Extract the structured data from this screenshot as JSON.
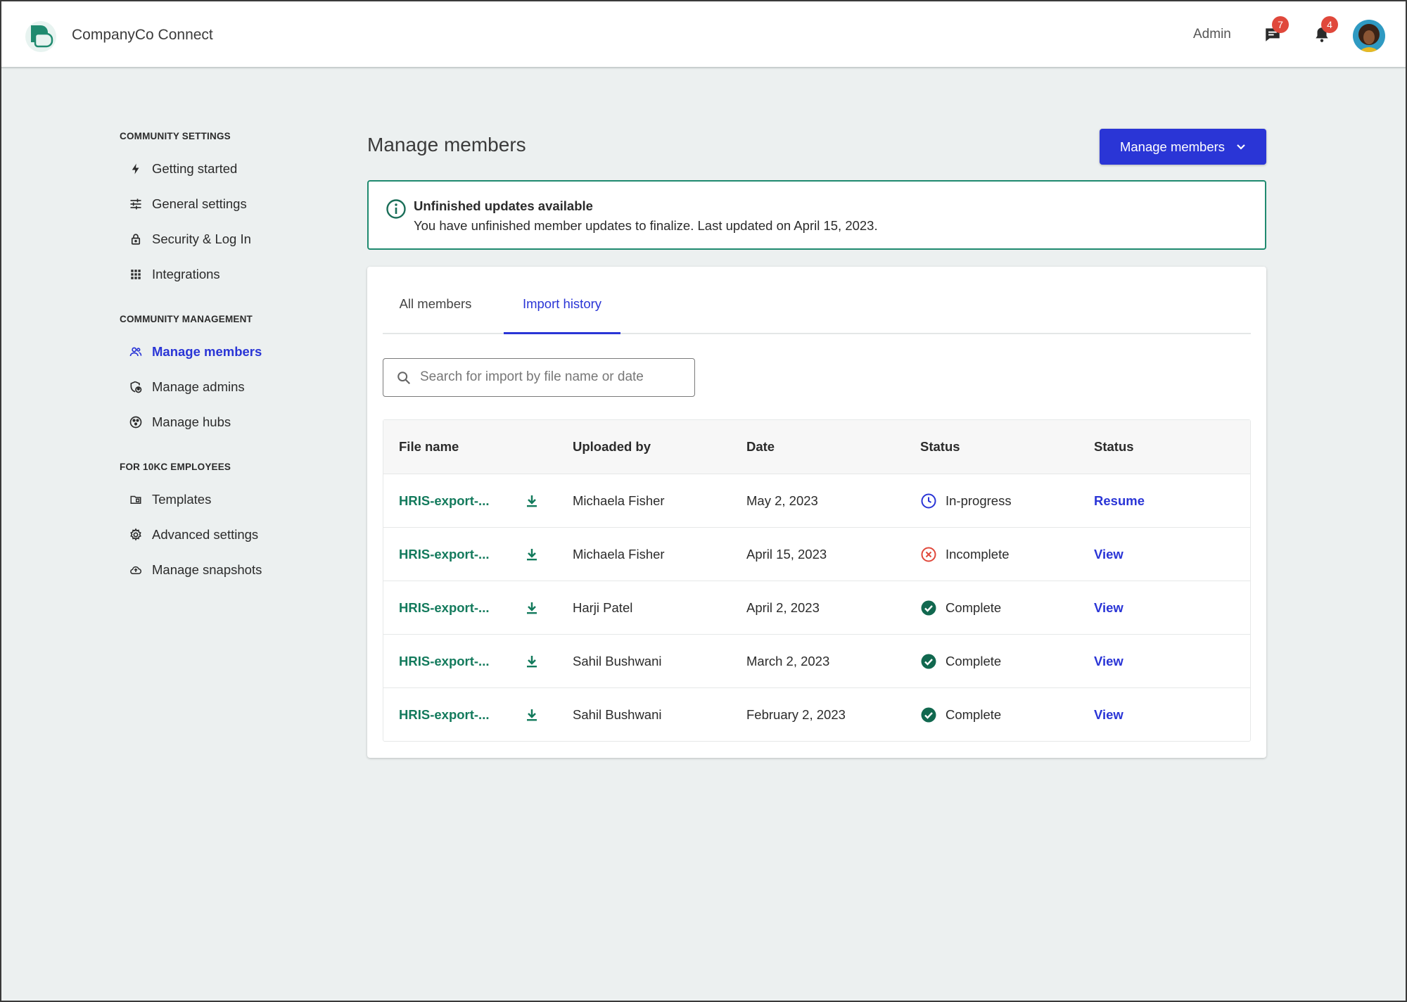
{
  "header": {
    "app_name": "CompanyCo Connect",
    "role_label": "Admin",
    "messages_count": "7",
    "notifications_count": "4"
  },
  "sidebar": {
    "sections": [
      {
        "title": "COMMUNITY SETTINGS",
        "items": [
          {
            "label": "Getting started",
            "icon": "bolt-icon"
          },
          {
            "label": "General settings",
            "icon": "sliders-icon"
          },
          {
            "label": "Security & Log In",
            "icon": "lock-icon"
          },
          {
            "label": "Integrations",
            "icon": "grid-icon"
          }
        ]
      },
      {
        "title": "COMMUNITY MANAGEMENT",
        "items": [
          {
            "label": "Manage members",
            "icon": "people-icon",
            "active": true
          },
          {
            "label": "Manage admins",
            "icon": "admin-shield-icon"
          },
          {
            "label": "Manage hubs",
            "icon": "hub-icon"
          }
        ]
      },
      {
        "title": "FOR 10KC EMPLOYEES",
        "items": [
          {
            "label": "Templates",
            "icon": "folder-icon"
          },
          {
            "label": "Advanced settings",
            "icon": "gear-icon"
          },
          {
            "label": "Manage snapshots",
            "icon": "cloud-upload-icon"
          }
        ]
      }
    ]
  },
  "main": {
    "title": "Manage members",
    "primary_button": "Manage members",
    "alert": {
      "title": "Unfinished updates available",
      "body": "You have unfinished member updates to finalize. Last updated on April 15, 2023."
    },
    "tabs": [
      "All members",
      "Import history"
    ],
    "active_tab": "Import history",
    "search_placeholder": "Search for import by file name or date",
    "table": {
      "columns": [
        "File name",
        "Uploaded by",
        "Date",
        "Status",
        "Status"
      ],
      "rows": [
        {
          "file": "HRIS-export-...",
          "uploaded_by": "Michaela Fisher",
          "date": "May 2, 2023",
          "status": "In-progress",
          "status_icon": "clock-icon",
          "action": "Resume"
        },
        {
          "file": "HRIS-export-...",
          "uploaded_by": "Michaela Fisher",
          "date": "April 15, 2023",
          "status": "Incomplete",
          "status_icon": "error-circle-icon",
          "action": "View"
        },
        {
          "file": "HRIS-export-...",
          "uploaded_by": "Harji Patel",
          "date": "April 2, 2023",
          "status": "Complete",
          "status_icon": "check-circle-icon",
          "action": "View"
        },
        {
          "file": "HRIS-export-...",
          "uploaded_by": "Sahil Bushwani",
          "date": "March 2, 2023",
          "status": "Complete",
          "status_icon": "check-circle-icon",
          "action": "View"
        },
        {
          "file": "HRIS-export-...",
          "uploaded_by": "Sahil Bushwani",
          "date": "February 2, 2023",
          "status": "Complete",
          "status_icon": "check-circle-icon",
          "action": "View"
        }
      ]
    }
  },
  "colors": {
    "primary": "#2a35d6",
    "brand_green": "#137a5c",
    "alert_border": "#1f8a6f",
    "error": "#e0483b",
    "background": "#ecf0f0"
  }
}
